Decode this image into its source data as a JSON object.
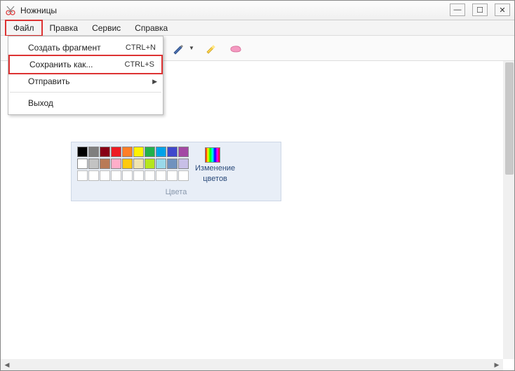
{
  "window": {
    "title": "Ножницы"
  },
  "menubar": {
    "items": [
      "Файл",
      "Правка",
      "Сервис",
      "Справка"
    ]
  },
  "file_menu": {
    "new": {
      "label": "Создать фрагмент",
      "shortcut": "CTRL+N"
    },
    "save_as": {
      "label": "Сохранить как...",
      "shortcut": "CTRL+S"
    },
    "send": {
      "label": "Отправить"
    },
    "exit": {
      "label": "Выход"
    }
  },
  "color_panel": {
    "edit_colors_label_1": "Изменение",
    "edit_colors_label_2": "цветов",
    "caption": "Цвета",
    "row1": [
      "#000000",
      "#7f7f7f",
      "#880015",
      "#ed1c24",
      "#ff7f27",
      "#fff200",
      "#22b14c",
      "#00a2e8",
      "#3f48cc",
      "#a349a4"
    ],
    "row2": [
      "#ffffff",
      "#c3c3c3",
      "#b97a57",
      "#ffaec9",
      "#ffc90e",
      "#efe4b0",
      "#b5e61d",
      "#99d9ea",
      "#7092be",
      "#c8bfe7"
    ]
  }
}
